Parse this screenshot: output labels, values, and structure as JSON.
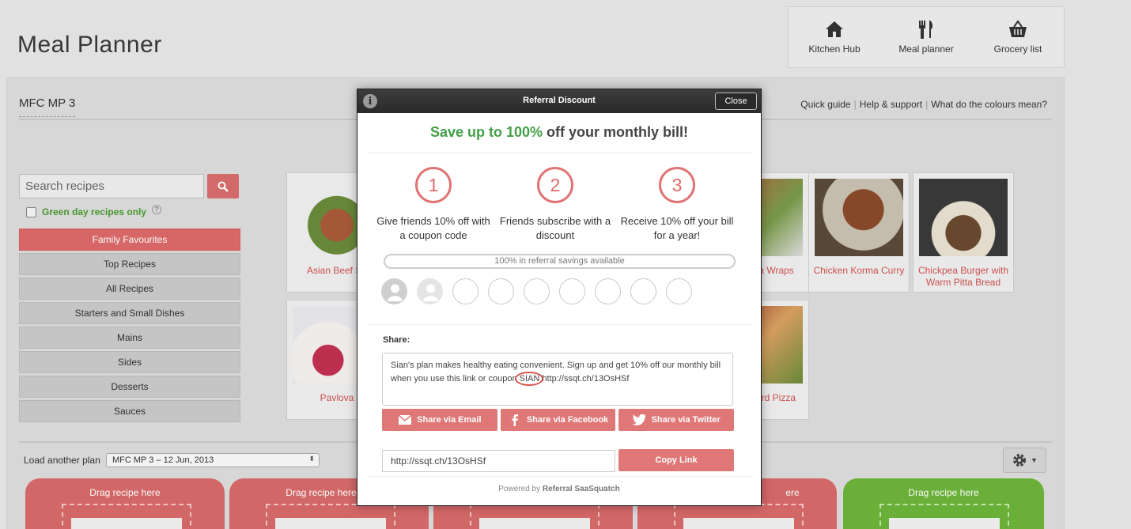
{
  "page": {
    "title": "Meal Planner"
  },
  "topnav": [
    {
      "label": "Kitchen Hub",
      "icon": "house-icon"
    },
    {
      "label": "Meal planner",
      "icon": "fork-knife-icon"
    },
    {
      "label": "Grocery list",
      "icon": "basket-icon"
    }
  ],
  "plan": {
    "name": "MFC MP 3"
  },
  "help_links": [
    "Quick guide",
    "Help & support",
    "What do the colours mean?"
  ],
  "search": {
    "placeholder": "Search recipes"
  },
  "green_day": {
    "label": "Green day recipes only",
    "help": "?"
  },
  "categories": [
    "Family Favourites",
    "Top Recipes",
    "All Recipes",
    "Starters and Small Dishes",
    "Mains",
    "Sides",
    "Desserts",
    "Sauces"
  ],
  "recipes": [
    "Asian Beef Sa",
    "ta Wraps",
    "Chicken Korma Curry",
    "Chickpea Burger with Warm Pitta Bread",
    "Pavlova",
    "ard Pizza"
  ],
  "load_plan": {
    "label": "Load another plan",
    "selected": "MFC MP 3 – 12 Jun, 2013"
  },
  "slots": [
    "Drag recipe here",
    "Drag recipe here",
    "ere",
    "Drag recipe here"
  ],
  "modal": {
    "title": "Referral Discount",
    "close": "Close",
    "headline_accent": "Save up to 100%",
    "headline_rest": " off your monthly bill!",
    "steps": [
      {
        "num": "1",
        "text": "Give friends 10% off with a coupon code"
      },
      {
        "num": "2",
        "text": "Friends subscribe with a discount"
      },
      {
        "num": "3",
        "text": "Receive 10% off your bill for a year!"
      }
    ],
    "progress": "100% in referral savings available",
    "share_label": "Share:",
    "share_text_1": "Sian's plan makes healthy eating convenient. Sign up and get 10% off our monthly bill when you use this link or coupon ",
    "share_code": "SIAN",
    "share_text_2": " http://ssqt.ch/13OsHSf",
    "btn_email": "Share via Email",
    "btn_facebook": "Share via Facebook",
    "btn_twitter": "Share via Twitter",
    "link": "http://ssqt.ch/13OsHSf",
    "copy": "Copy Link",
    "powered_prefix": "Powered by ",
    "powered_brand": "Referral SaaSquatch"
  },
  "colors": {
    "accent_red": "#e07777",
    "accent_green": "#43a047"
  }
}
